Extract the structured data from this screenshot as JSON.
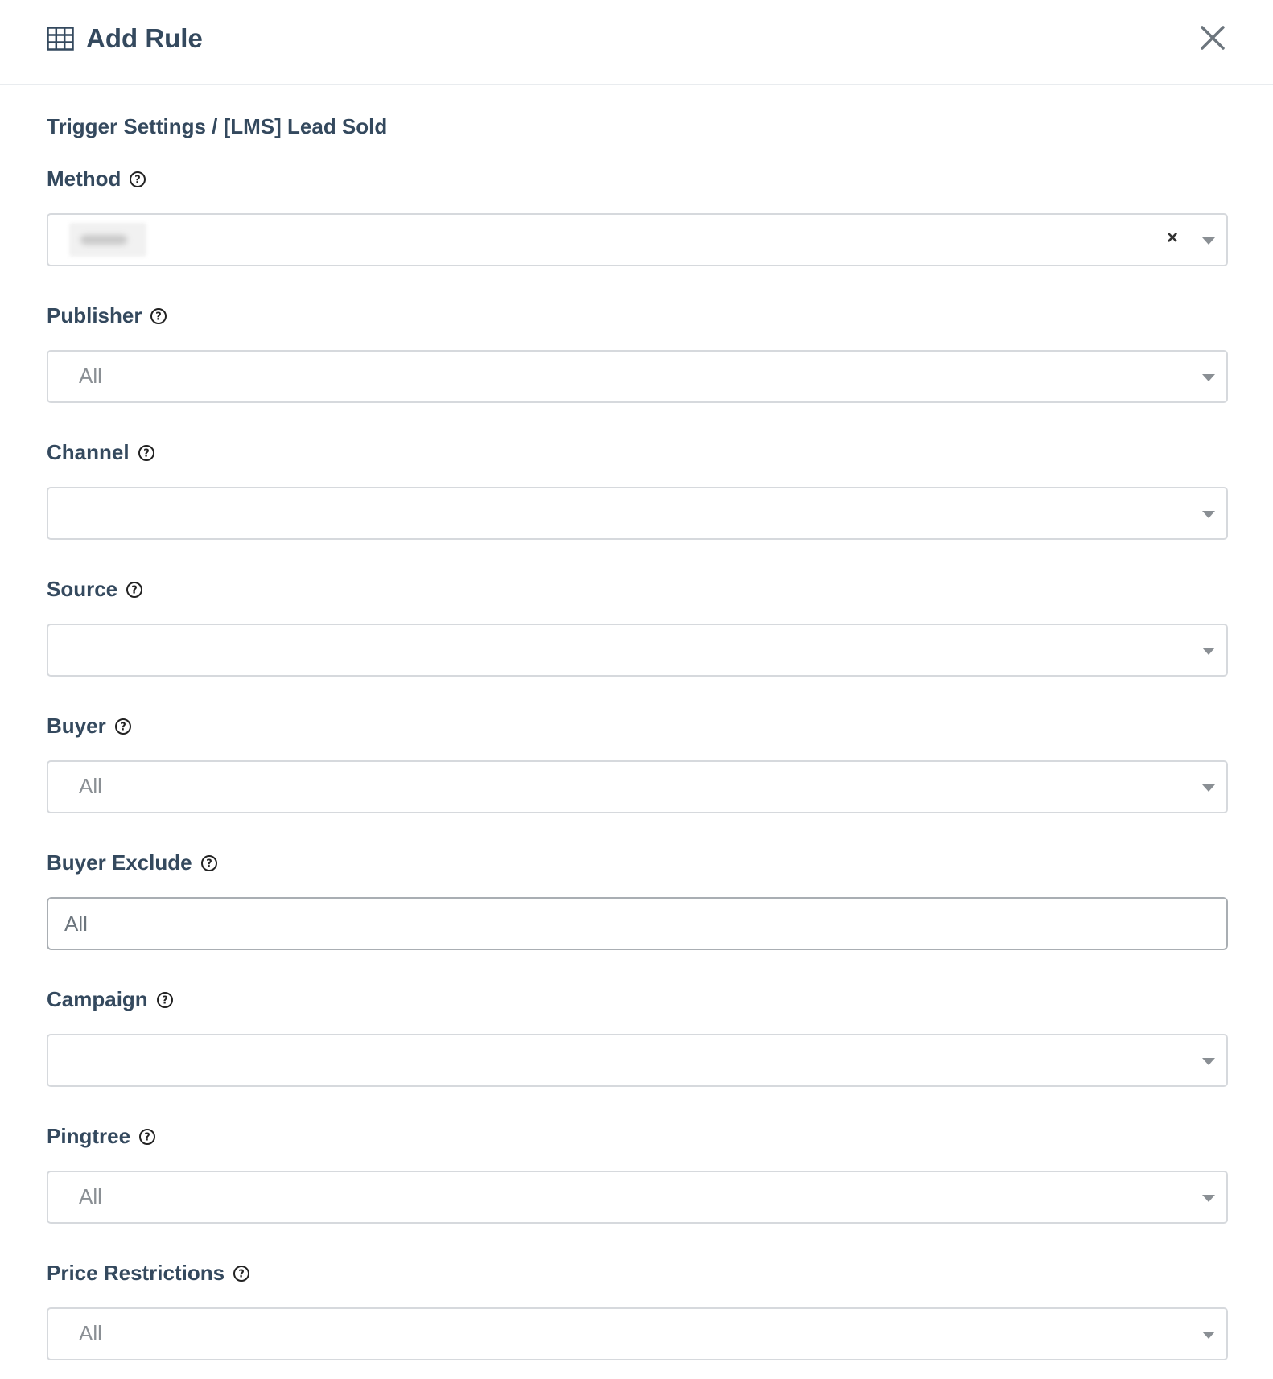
{
  "header": {
    "title": "Add Rule",
    "icon": "table-icon",
    "close_icon": "close-icon"
  },
  "breadcrumb": "Trigger Settings / [LMS] Lead Sold",
  "fields": {
    "method": {
      "label": "Method",
      "value": "",
      "clearable": true
    },
    "publisher": {
      "label": "Publisher",
      "value": "All"
    },
    "channel": {
      "label": "Channel",
      "value": ""
    },
    "source": {
      "label": "Source",
      "value": ""
    },
    "buyer": {
      "label": "Buyer",
      "value": "All"
    },
    "buyer_exclude": {
      "label": "Buyer Exclude",
      "placeholder": "All"
    },
    "campaign": {
      "label": "Campaign",
      "value": ""
    },
    "pingtree": {
      "label": "Pingtree",
      "value": "All"
    },
    "price_restrictions": {
      "label": "Price Restrictions",
      "value": "All"
    }
  },
  "clear_symbol": "×",
  "colors": {
    "text": "#34495e",
    "border": "#d6d9dd",
    "placeholder": "#8a8f94"
  }
}
